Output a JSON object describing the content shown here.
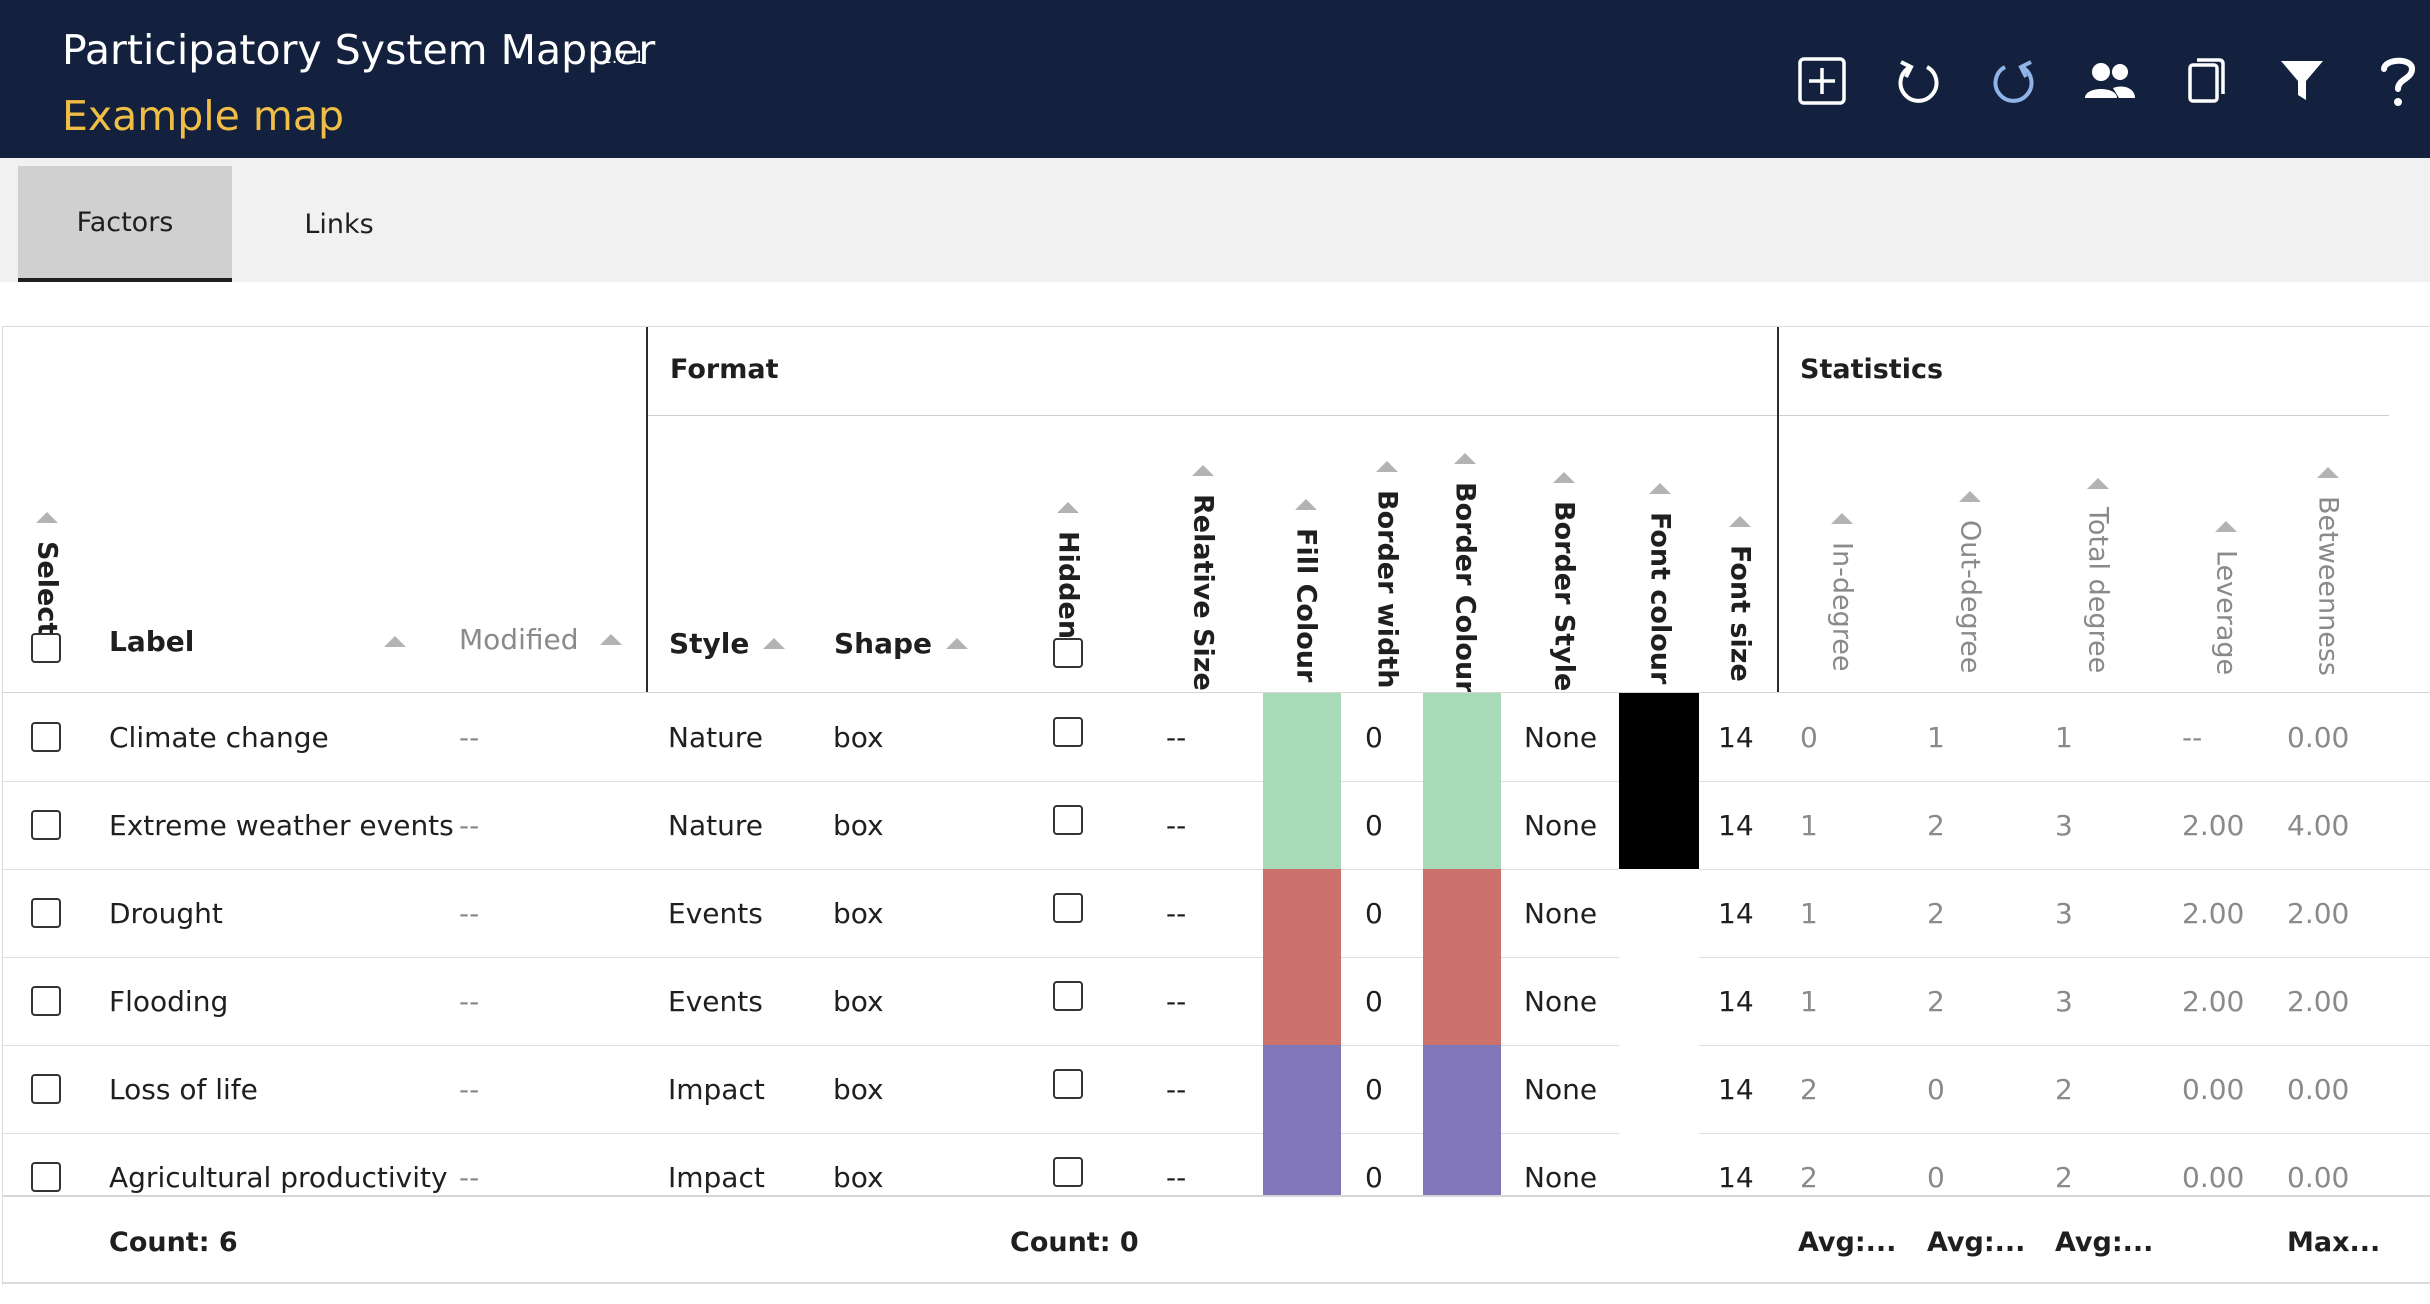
{
  "header": {
    "app_title": "Participatory System Mapper",
    "version": "1.7.1",
    "map_title": "Example map",
    "buttons": [
      {
        "name": "add-factor-icon"
      },
      {
        "name": "undo-icon"
      },
      {
        "name": "redo-icon"
      },
      {
        "name": "users-icon"
      },
      {
        "name": "copy-icon"
      },
      {
        "name": "filter-icon"
      },
      {
        "name": "help-icon"
      }
    ]
  },
  "tabs": [
    {
      "label": "Factors",
      "active": true
    },
    {
      "label": "Links",
      "active": false
    }
  ],
  "groups": {
    "format": "Format",
    "statistics": "Statistics"
  },
  "columns": {
    "select": "Select",
    "label": "Label",
    "modified": "Modified",
    "style": "Style",
    "shape": "Shape",
    "hidden": "Hidden",
    "relative_size": "Relative Size",
    "fill_colour": "Fill Colour",
    "border_width": "Border width",
    "border_colour": "Border Colour",
    "border_style": "Border Style",
    "font_colour": "Font colour",
    "font_size": "Font size",
    "in_degree": "In-degree",
    "out_degree": "Out-degree",
    "total_degree": "Total degree",
    "leverage": "Leverage",
    "betweenness": "Betweenness"
  },
  "rows": [
    {
      "label": "Climate change",
      "modified": "--",
      "style": "Nature",
      "shape": "box",
      "relative_size": "--",
      "fill": "#a8dab9",
      "border_width": "0",
      "border_colour": "#a8dab9",
      "border_style": "None",
      "font_colour": "#000000",
      "font_size": "14",
      "in": "0",
      "out": "1",
      "total": "1",
      "leverage": "--",
      "betweenness": "0.00"
    },
    {
      "label": "Extreme weather events",
      "modified": "--",
      "style": "Nature",
      "shape": "box",
      "relative_size": "--",
      "fill": "#a8dab9",
      "border_width": "0",
      "border_colour": "#a8dab9",
      "border_style": "None",
      "font_colour": "#000000",
      "font_size": "14",
      "in": "1",
      "out": "2",
      "total": "3",
      "leverage": "2.00",
      "betweenness": "4.00"
    },
    {
      "label": "Drought",
      "modified": "--",
      "style": "Events",
      "shape": "box",
      "relative_size": "--",
      "fill": "#cc716b",
      "border_width": "0",
      "border_colour": "#cc716b",
      "border_style": "None",
      "font_colour": "#ffffff",
      "font_size": "14",
      "in": "1",
      "out": "2",
      "total": "3",
      "leverage": "2.00",
      "betweenness": "2.00"
    },
    {
      "label": "Flooding",
      "modified": "--",
      "style": "Events",
      "shape": "box",
      "relative_size": "--",
      "fill": "#cc716b",
      "border_width": "0",
      "border_colour": "#cc716b",
      "border_style": "None",
      "font_colour": "#ffffff",
      "font_size": "14",
      "in": "1",
      "out": "2",
      "total": "3",
      "leverage": "2.00",
      "betweenness": "2.00"
    },
    {
      "label": "Loss of life",
      "modified": "--",
      "style": "Impact",
      "shape": "box",
      "relative_size": "--",
      "fill": "#8076b8",
      "border_width": "0",
      "border_colour": "#8076b8",
      "border_style": "None",
      "font_colour": "#ffffff",
      "font_size": "14",
      "in": "2",
      "out": "0",
      "total": "2",
      "leverage": "0.00",
      "betweenness": "0.00"
    },
    {
      "label": "Agricultural productivity",
      "modified": "--",
      "style": "Impact",
      "shape": "box",
      "relative_size": "--",
      "fill": "#8076b8",
      "border_width": "0",
      "border_colour": "#8076b8",
      "border_style": "None",
      "font_colour": "#ffffff",
      "font_size": "14",
      "in": "2",
      "out": "0",
      "total": "2",
      "leverage": "0.00",
      "betweenness": "0.00"
    }
  ],
  "footer": {
    "count": "Count: 6",
    "hidden_count": "Count: 0",
    "avg_in": "Avg:...",
    "avg_out": "Avg:...",
    "avg_total": "Avg:...",
    "max_betweenness": "Max..."
  }
}
